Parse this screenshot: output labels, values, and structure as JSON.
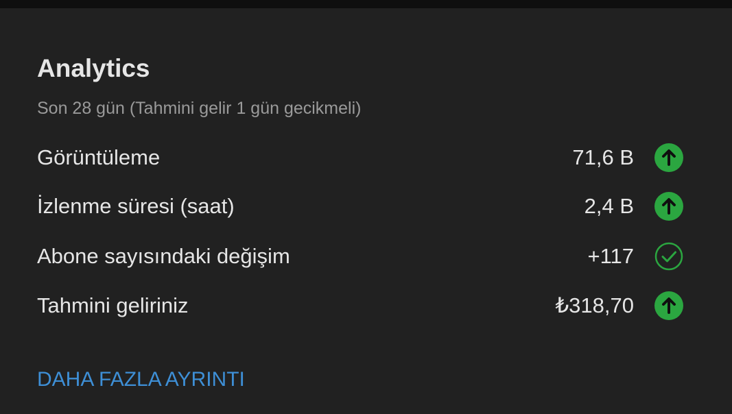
{
  "card": {
    "title": "Analytics",
    "subtitle": "Son 28 gün (Tahmini gelir 1 gün gecikmeli)",
    "more_link": "DAHA FAZLA AYRINTI"
  },
  "metrics": [
    {
      "label": "Görüntüleme",
      "value": "71,6 B",
      "icon": "arrow-up-icon"
    },
    {
      "label": "İzlenme süresi (saat)",
      "value": "2,4 B",
      "icon": "arrow-up-icon"
    },
    {
      "label": "Abone sayısındaki değişim",
      "value": "+117",
      "icon": "check-circle-icon"
    },
    {
      "label": "Tahmini geliriniz",
      "value": "₺318,70",
      "icon": "arrow-up-icon"
    }
  ],
  "colors": {
    "background": "#212121",
    "text_primary": "#e6e6e6",
    "text_secondary": "#9a9a9a",
    "accent_green": "#2ba640",
    "link_blue": "#3e8fd6"
  }
}
